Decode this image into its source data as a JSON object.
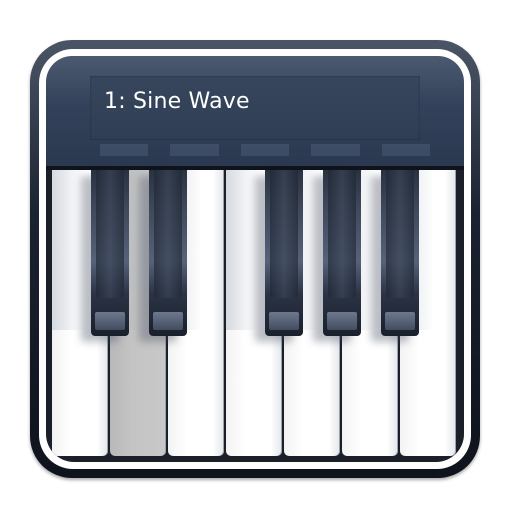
{
  "display": {
    "text": "1: Sine Wave"
  },
  "keyboard": {
    "white_keys": [
      {
        "note": "C",
        "pressed": false
      },
      {
        "note": "D",
        "pressed": true
      },
      {
        "note": "E",
        "pressed": false
      },
      {
        "note": "F",
        "pressed": false
      },
      {
        "note": "G",
        "pressed": false
      },
      {
        "note": "A",
        "pressed": false
      },
      {
        "note": "B",
        "pressed": false
      }
    ],
    "black_keys": [
      "C#",
      "D#",
      "F#",
      "G#",
      "A#"
    ]
  },
  "colors": {
    "frame": "#1b2230",
    "bezel": "#33425a",
    "display_bg": "#2f3e54",
    "display_text": "#ffffff",
    "pressed_key": "#c4c4c4",
    "white_key": "#ffffff",
    "black_key": "#2a3242"
  },
  "icon": "piano-app-icon"
}
